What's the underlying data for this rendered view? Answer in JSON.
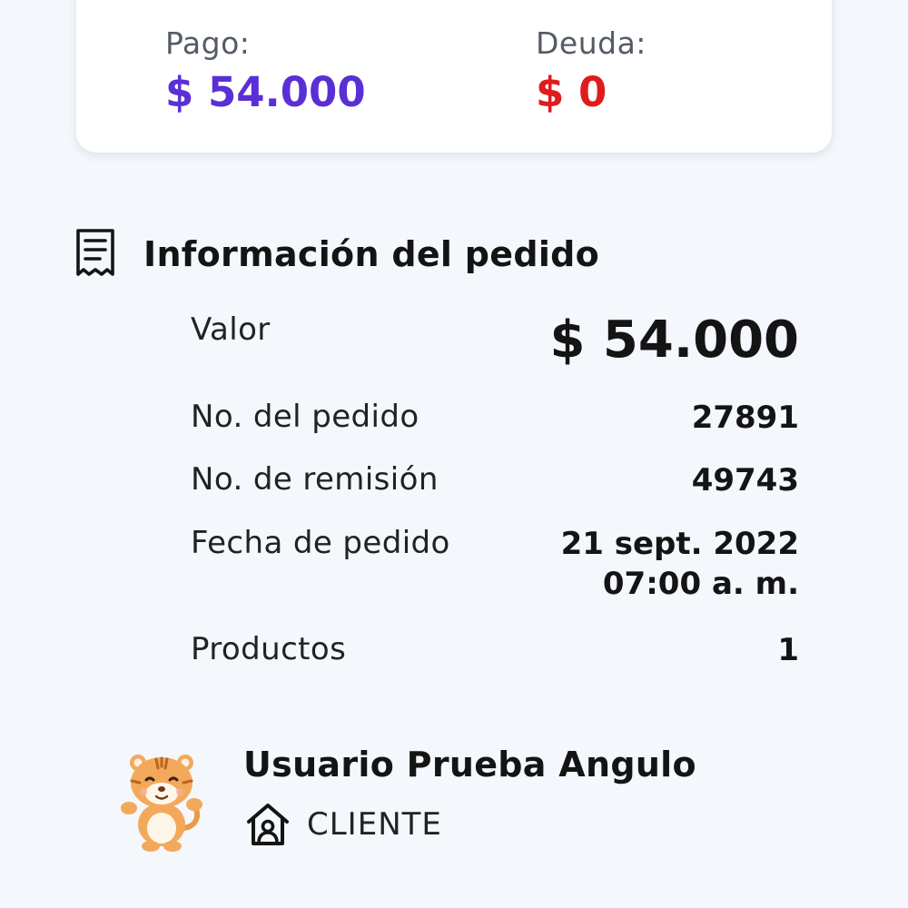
{
  "summary": {
    "pago_label": "Pago:",
    "pago_value": "$ 54.000",
    "deuda_label": "Deuda:",
    "deuda_value": "$ 0",
    "colors": {
      "pago": "#5a2fd6",
      "deuda": "#e01b1b"
    }
  },
  "order_info": {
    "title": "Información del pedido",
    "icon": "receipt-icon",
    "valor_label": "Valor",
    "valor_value": "$ 54.000",
    "pedido_label": "No. del pedido",
    "pedido_value": "27891",
    "remision_label": "No. de remisión",
    "remision_value": "49743",
    "fecha_label": "Fecha de pedido",
    "fecha_date": "21 sept. 2022",
    "fecha_time": "07:00 a. m.",
    "productos_label": "Productos",
    "productos_value": "1"
  },
  "user": {
    "name": "Usuario Prueba Angulo",
    "role": "CLIENTE",
    "avatar_icon": "tiger-mascot-icon",
    "role_icon": "house-user-icon"
  }
}
